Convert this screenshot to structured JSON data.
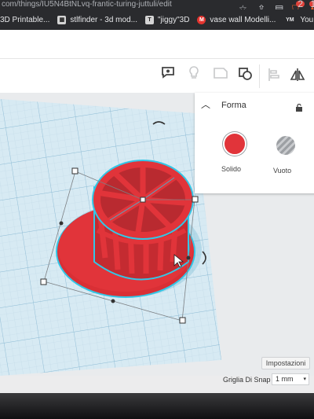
{
  "browser": {
    "url": "com/things/IU5N4BtNLvq-frantic-turing-juttuli/edit",
    "bookmarks": [
      {
        "icon": "page-icon",
        "label": "3D Printable..."
      },
      {
        "icon": "stlfinder-icon",
        "label": "stlfinder - 3d mod..."
      },
      {
        "icon": "thingiverse-icon",
        "label": "\"jiggy\"3D"
      },
      {
        "icon": "makerbot-icon",
        "label": "vase wall Modelli..."
      },
      {
        "icon": "youmagine-icon",
        "label": "YouMagine – You"
      }
    ],
    "brave_badge": "2",
    "alert_badge": "13"
  },
  "panel": {
    "title": "Forma",
    "solid_label": "Solido",
    "hole_label": "Vuoto",
    "solid_color": "#e1343a"
  },
  "controls": {
    "settings_label": "Impostazioni",
    "snap_label": "Griglia Di Snap",
    "snap_value": "1 mm"
  },
  "colors": {
    "shape_red": "#e1343a",
    "selection_cyan": "#33c6e6"
  }
}
